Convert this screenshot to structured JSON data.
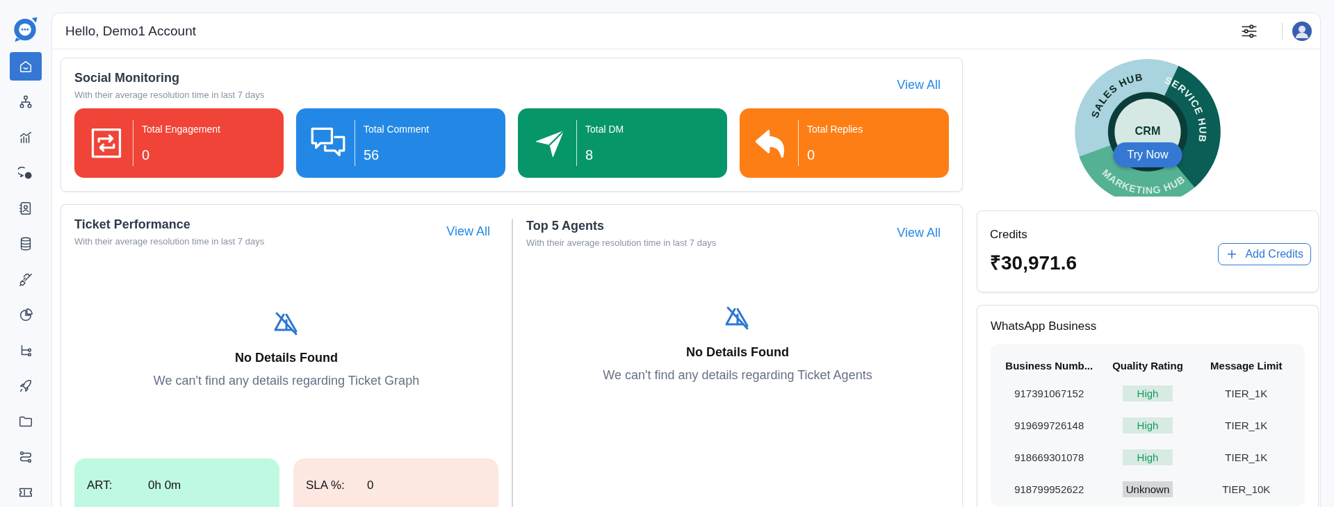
{
  "header": {
    "greeting": "Hello, Demo1 Account"
  },
  "sidebar": {
    "items": [
      {
        "kind": "home",
        "selected": true
      },
      {
        "kind": "hierarchy",
        "selected": false
      },
      {
        "kind": "analytics",
        "selected": false
      },
      {
        "kind": "chat",
        "selected": false
      },
      {
        "kind": "contacts",
        "selected": false
      },
      {
        "kind": "database",
        "selected": false
      },
      {
        "kind": "plug",
        "selected": false
      },
      {
        "kind": "pie",
        "selected": false
      },
      {
        "kind": "flow",
        "selected": false
      },
      {
        "kind": "rocket",
        "selected": false
      },
      {
        "kind": "folder",
        "selected": false
      },
      {
        "kind": "route",
        "selected": false
      },
      {
        "kind": "ticket",
        "selected": false
      }
    ]
  },
  "social": {
    "title": "Social Monitoring",
    "subtitle": "With their average resolution time in last 7 days",
    "link": "View All",
    "stats": [
      {
        "kind": "engagement",
        "label": "Total Engagement",
        "value": "0",
        "color": "#f04438"
      },
      {
        "kind": "comment",
        "label": "Total Comment",
        "value": "56",
        "color": "#2388e5"
      },
      {
        "kind": "dm",
        "label": "Total DM",
        "value": "8",
        "color": "#079669"
      },
      {
        "kind": "replies",
        "label": "Total Replies",
        "value": "0",
        "color": "#fd7e14"
      }
    ]
  },
  "ticket_performance": {
    "title": "Ticket Performance",
    "subtitle": "With their average resolution time in last 7 days",
    "link": "View All",
    "empty_title": "No Details Found",
    "empty_message": "We can't find any details regarding Ticket Graph",
    "metrics": [
      {
        "kind": "art",
        "label": "ART:",
        "value": "0h 0m"
      },
      {
        "kind": "sla",
        "label": "SLA %:",
        "value": "0"
      }
    ]
  },
  "top_agents": {
    "title": "Top 5 Agents",
    "subtitle": "With their average resolution time in last 7 days",
    "link": "View All",
    "empty_title": "No Details Found",
    "empty_message": "We can't find any details regarding Ticket Agents"
  },
  "promo": {
    "center": "CRM",
    "segments": [
      "SALES HUB",
      "SERVICE HUB",
      "MARKETING HUB"
    ],
    "button": "Try Now"
  },
  "credits": {
    "title": "Credits",
    "amount": "₹30,971.6",
    "button": "Add Credits"
  },
  "whatsapp": {
    "title": "WhatsApp Business",
    "columns": [
      "Business Numb...",
      "Quality Rating",
      "Message Limit"
    ],
    "rows": [
      {
        "number": "917391067152",
        "rating": "High",
        "color": "#179a5e",
        "limit": "TIER_1K"
      },
      {
        "number": "919699726148",
        "rating": "High",
        "color": "#179a5e",
        "limit": "TIER_1K"
      },
      {
        "number": "918669301078",
        "rating": "High",
        "color": "#179a5e",
        "limit": "TIER_1K"
      },
      {
        "number": "918799952622",
        "rating": "Unknown",
        "color": "#111111",
        "limit": "TIER_10K"
      }
    ]
  }
}
